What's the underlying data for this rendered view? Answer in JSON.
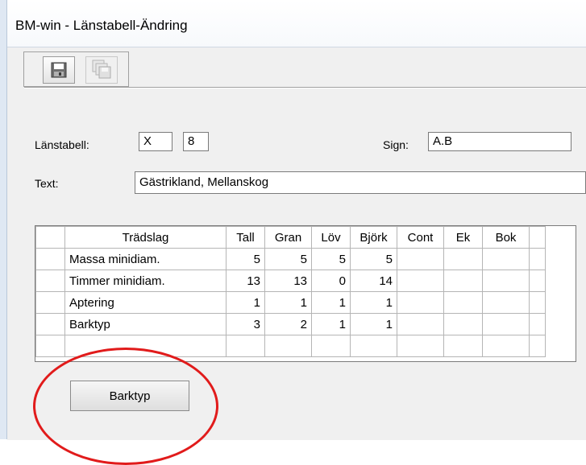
{
  "window": {
    "title": "BM-win - Länstabell-Ändring"
  },
  "toolbar": {
    "buttons": [
      {
        "icon": "save-icon"
      },
      {
        "icon": "save-multiple-icon"
      }
    ]
  },
  "form": {
    "lanstabell_label": "Länstabell:",
    "lanstabell_letter": "X",
    "lanstabell_number": "8",
    "sign_label": "Sign:",
    "sign_value": "A.B",
    "text_label": "Text:",
    "text_value": "Gästrikland, Mellanskog"
  },
  "grid": {
    "columns": [
      "Trädslag",
      "Tall",
      "Gran",
      "Löv",
      "Björk",
      "Cont",
      "Ek",
      "Bok"
    ],
    "rows": [
      {
        "label": "Massa minidiam.",
        "values": [
          "5",
          "5",
          "5",
          "5",
          "",
          "",
          ""
        ]
      },
      {
        "label": "Timmer minidiam.",
        "values": [
          "13",
          "13",
          "0",
          "14",
          "",
          "",
          ""
        ]
      },
      {
        "label": "Aptering",
        "values": [
          "1",
          "1",
          "1",
          "1",
          "",
          "",
          ""
        ]
      },
      {
        "label": "Barktyp",
        "values": [
          "3",
          "2",
          "1",
          "1",
          "",
          "",
          ""
        ]
      }
    ]
  },
  "barktyp_button": {
    "label": "Barktyp"
  },
  "annotation": {
    "color": "#e11b1b"
  }
}
